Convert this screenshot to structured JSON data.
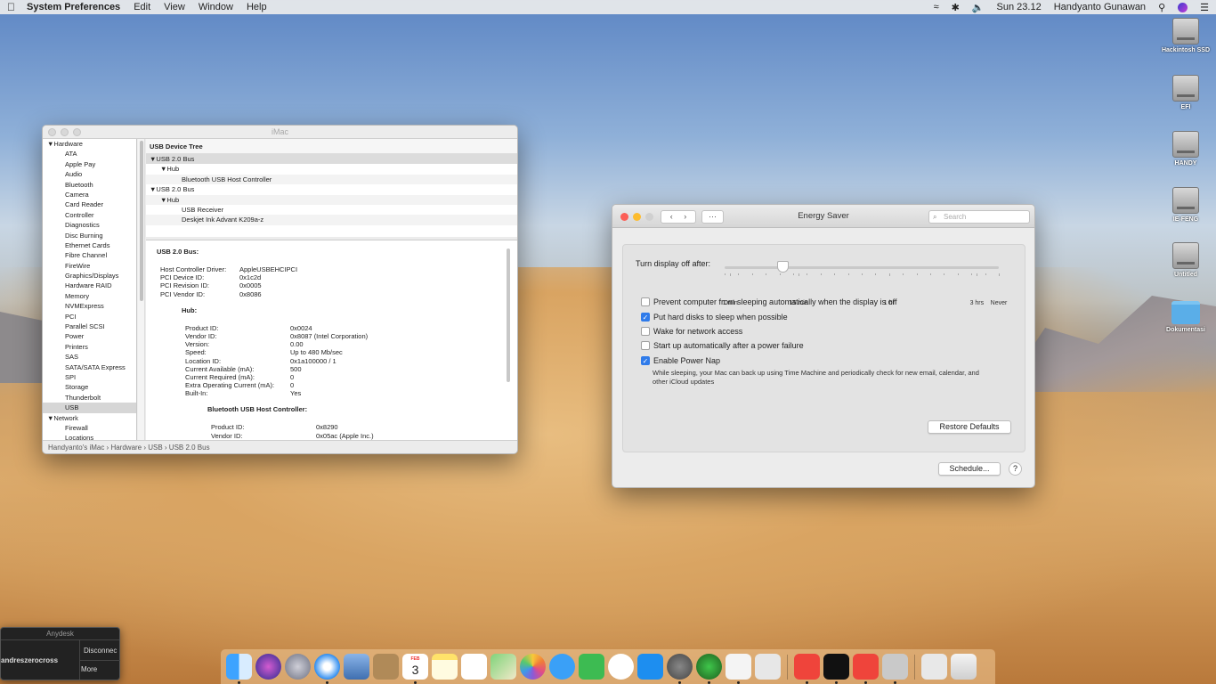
{
  "menubar": {
    "app": "System Preferences",
    "items": [
      "Edit",
      "View",
      "Window",
      "Help"
    ],
    "clock": "Sun 23.12",
    "user": "Handyanto Gunawan"
  },
  "desktop_icons": [
    "Hackintosh SSD",
    "EFI",
    "HANDY",
    "IE-FENG",
    "Untitled",
    "Dokumentasi"
  ],
  "sysinfo": {
    "title": "iMac",
    "sidebar": [
      {
        "label": "Hardware",
        "group": true
      },
      {
        "label": "ATA"
      },
      {
        "label": "Apple Pay"
      },
      {
        "label": "Audio"
      },
      {
        "label": "Bluetooth"
      },
      {
        "label": "Camera"
      },
      {
        "label": "Card Reader"
      },
      {
        "label": "Controller"
      },
      {
        "label": "Diagnostics"
      },
      {
        "label": "Disc Burning"
      },
      {
        "label": "Ethernet Cards"
      },
      {
        "label": "Fibre Channel"
      },
      {
        "label": "FireWire"
      },
      {
        "label": "Graphics/Displays"
      },
      {
        "label": "Hardware RAID"
      },
      {
        "label": "Memory"
      },
      {
        "label": "NVMExpress"
      },
      {
        "label": "PCI"
      },
      {
        "label": "Parallel SCSI"
      },
      {
        "label": "Power"
      },
      {
        "label": "Printers"
      },
      {
        "label": "SAS"
      },
      {
        "label": "SATA/SATA Express"
      },
      {
        "label": "SPI"
      },
      {
        "label": "Storage"
      },
      {
        "label": "Thunderbolt"
      },
      {
        "label": "USB",
        "selected": true
      },
      {
        "label": "Network",
        "group": true
      },
      {
        "label": "Firewall"
      },
      {
        "label": "Locations"
      }
    ],
    "tree_header": "USB Device Tree",
    "tree": [
      {
        "label": "▼USB 2.0 Bus",
        "indent": 0,
        "selected": true
      },
      {
        "label": "▼Hub",
        "indent": 1
      },
      {
        "label": "Bluetooth USB Host Controller",
        "indent": 3
      },
      {
        "label": "▼USB 2.0 Bus",
        "indent": 0
      },
      {
        "label": "▼Hub",
        "indent": 1
      },
      {
        "label": "USB Receiver",
        "indent": 3
      },
      {
        "label": "Deskjet Ink Advant K209a-z",
        "indent": 3
      }
    ],
    "detail": {
      "bus_title": "USB 2.0 Bus:",
      "bus": [
        [
          "Host Controller Driver:",
          "AppleUSBEHCIPCI"
        ],
        [
          "PCI Device ID:",
          "0x1c2d"
        ],
        [
          "PCI Revision ID:",
          "0x0005"
        ],
        [
          "PCI Vendor ID:",
          "0x8086"
        ]
      ],
      "hub_title": "Hub:",
      "hub": [
        [
          "Product ID:",
          "0x0024"
        ],
        [
          "Vendor ID:",
          "0x8087  (Intel Corporation)"
        ],
        [
          "Version:",
          "0.00"
        ],
        [
          "Speed:",
          "Up to 480 Mb/sec"
        ],
        [
          "Location ID:",
          "0x1a100000 / 1"
        ],
        [
          "Current Available (mA):",
          "500"
        ],
        [
          "Current Required (mA):",
          "0"
        ],
        [
          "Extra Operating Current (mA):",
          "0"
        ],
        [
          "Built-In:",
          "Yes"
        ]
      ],
      "bt_title": "Bluetooth USB Host Controller:",
      "bt": [
        [
          "Product ID:",
          "0x8290"
        ],
        [
          "Vendor ID:",
          "0x05ac (Apple Inc.)"
        ]
      ]
    },
    "path": "Handyanto's iMac  ›  Hardware  ›  USB  ›  USB 2.0 Bus"
  },
  "energy": {
    "title": "Energy Saver",
    "search_placeholder": "Search",
    "slider_label": "Turn display off after:",
    "slider_value_fraction": 0.21,
    "ticks": [
      {
        "label": "1 min",
        "pos": 0.02
      },
      {
        "label": "15 min",
        "pos": 0.27
      },
      {
        "label": "1 hr",
        "pos": 0.6
      },
      {
        "label": "3 hrs",
        "pos": 0.92
      },
      {
        "label": "Never",
        "pos": 1.0
      }
    ],
    "options": [
      {
        "label": "Prevent computer from sleeping automatically when the display is off",
        "checked": false
      },
      {
        "label": "Put hard disks to sleep when possible",
        "checked": true
      },
      {
        "label": "Wake for network access",
        "checked": false
      },
      {
        "label": "Start up automatically after a power failure",
        "checked": false
      },
      {
        "label": "Enable Power Nap",
        "checked": true
      }
    ],
    "power_nap_note": "While sleeping, your Mac can back up using Time Machine and periodically check for new email, calendar, and other iCloud updates",
    "restore_label": "Restore Defaults",
    "schedule_label": "Schedule...",
    "help_label": "?"
  },
  "anydesk": {
    "title": "Anydesk",
    "user": "andreszerocross",
    "disconnect": "Disconnec",
    "more": "More"
  },
  "dock": [
    "finder",
    "siri",
    "launchpad",
    "safari",
    "preview",
    "contacts",
    "calendar",
    "notes",
    "reminders",
    "maps",
    "photos",
    "messages",
    "facetime",
    "itunes",
    "app-store",
    "system-preferences",
    "network-utility",
    "textedit",
    "system-information",
    "anydesk",
    "terminal",
    "anydesk-2",
    "printer",
    "downloads",
    "trash"
  ],
  "calendar_day": "3",
  "calendar_month": "FEB"
}
